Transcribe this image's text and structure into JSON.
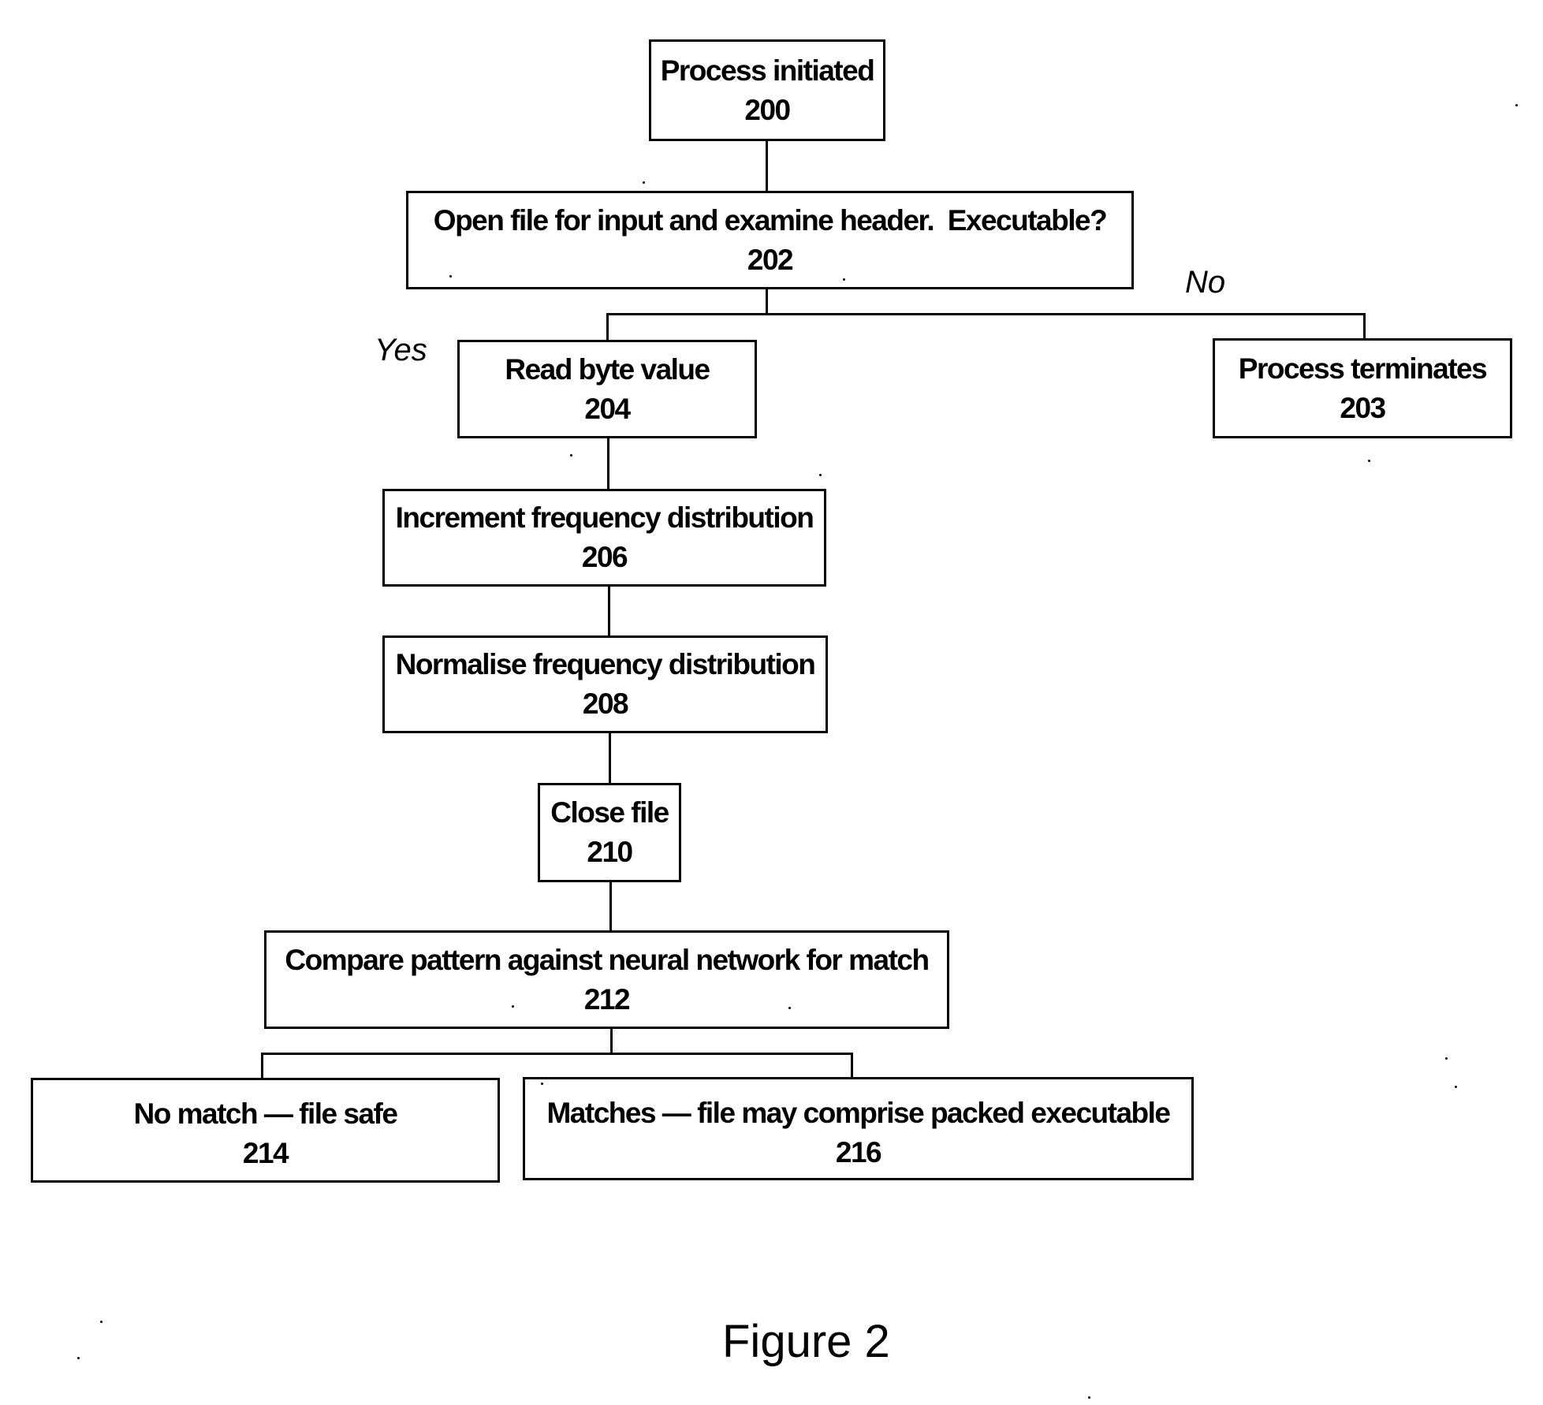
{
  "figure": {
    "caption": "Figure 2"
  },
  "nodes": [
    {
      "id": "200",
      "label": "Process initiated",
      "number": "200"
    },
    {
      "id": "202",
      "label": "Open file for input and examine header.  Executable?",
      "number": "202"
    },
    {
      "id": "203",
      "label": "Process terminates",
      "number": "203"
    },
    {
      "id": "204",
      "label": "Read byte value",
      "number": "204"
    },
    {
      "id": "206",
      "label": "Increment frequency distribution",
      "number": "206"
    },
    {
      "id": "208",
      "label": "Normalise frequency distribution",
      "number": "208"
    },
    {
      "id": "210",
      "label": "Close file",
      "number": "210"
    },
    {
      "id": "212",
      "label": "Compare pattern against neural network for match",
      "number": "212"
    },
    {
      "id": "214",
      "label": "No match — file safe",
      "number": "214"
    },
    {
      "id": "216",
      "label": "Matches — file may comprise packed executable",
      "number": "216"
    }
  ],
  "edges": [
    {
      "from": "200",
      "to": "202",
      "label": ""
    },
    {
      "from": "202",
      "to": "204",
      "label": "Yes"
    },
    {
      "from": "202",
      "to": "203",
      "label": "No"
    },
    {
      "from": "204",
      "to": "206",
      "label": ""
    },
    {
      "from": "206",
      "to": "208",
      "label": ""
    },
    {
      "from": "208",
      "to": "210",
      "label": ""
    },
    {
      "from": "210",
      "to": "212",
      "label": ""
    },
    {
      "from": "212",
      "to": "214",
      "label": ""
    },
    {
      "from": "212",
      "to": "216",
      "label": ""
    }
  ],
  "branch_labels": {
    "yes": "Yes",
    "no": "No"
  }
}
